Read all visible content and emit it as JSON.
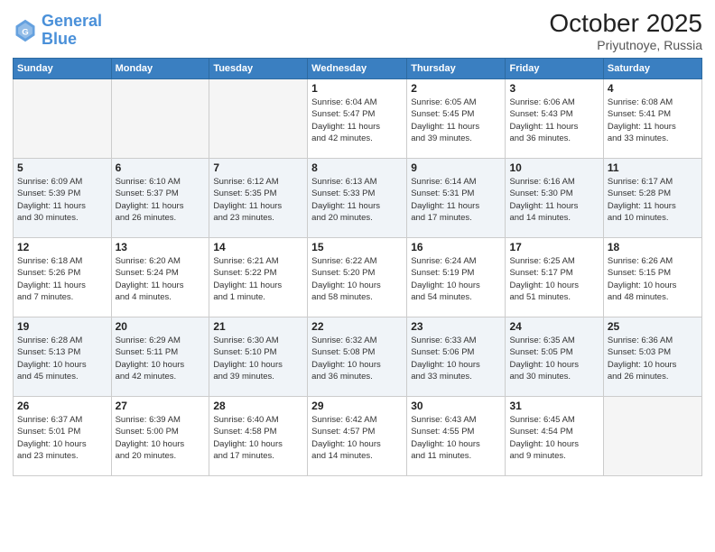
{
  "header": {
    "logo_line1": "General",
    "logo_line2": "Blue",
    "month": "October 2025",
    "location": "Priyutnoye, Russia"
  },
  "weekdays": [
    "Sunday",
    "Monday",
    "Tuesday",
    "Wednesday",
    "Thursday",
    "Friday",
    "Saturday"
  ],
  "weeks": [
    [
      {
        "day": "",
        "info": ""
      },
      {
        "day": "",
        "info": ""
      },
      {
        "day": "",
        "info": ""
      },
      {
        "day": "1",
        "info": "Sunrise: 6:04 AM\nSunset: 5:47 PM\nDaylight: 11 hours\nand 42 minutes."
      },
      {
        "day": "2",
        "info": "Sunrise: 6:05 AM\nSunset: 5:45 PM\nDaylight: 11 hours\nand 39 minutes."
      },
      {
        "day": "3",
        "info": "Sunrise: 6:06 AM\nSunset: 5:43 PM\nDaylight: 11 hours\nand 36 minutes."
      },
      {
        "day": "4",
        "info": "Sunrise: 6:08 AM\nSunset: 5:41 PM\nDaylight: 11 hours\nand 33 minutes."
      }
    ],
    [
      {
        "day": "5",
        "info": "Sunrise: 6:09 AM\nSunset: 5:39 PM\nDaylight: 11 hours\nand 30 minutes."
      },
      {
        "day": "6",
        "info": "Sunrise: 6:10 AM\nSunset: 5:37 PM\nDaylight: 11 hours\nand 26 minutes."
      },
      {
        "day": "7",
        "info": "Sunrise: 6:12 AM\nSunset: 5:35 PM\nDaylight: 11 hours\nand 23 minutes."
      },
      {
        "day": "8",
        "info": "Sunrise: 6:13 AM\nSunset: 5:33 PM\nDaylight: 11 hours\nand 20 minutes."
      },
      {
        "day": "9",
        "info": "Sunrise: 6:14 AM\nSunset: 5:31 PM\nDaylight: 11 hours\nand 17 minutes."
      },
      {
        "day": "10",
        "info": "Sunrise: 6:16 AM\nSunset: 5:30 PM\nDaylight: 11 hours\nand 14 minutes."
      },
      {
        "day": "11",
        "info": "Sunrise: 6:17 AM\nSunset: 5:28 PM\nDaylight: 11 hours\nand 10 minutes."
      }
    ],
    [
      {
        "day": "12",
        "info": "Sunrise: 6:18 AM\nSunset: 5:26 PM\nDaylight: 11 hours\nand 7 minutes."
      },
      {
        "day": "13",
        "info": "Sunrise: 6:20 AM\nSunset: 5:24 PM\nDaylight: 11 hours\nand 4 minutes."
      },
      {
        "day": "14",
        "info": "Sunrise: 6:21 AM\nSunset: 5:22 PM\nDaylight: 11 hours\nand 1 minute."
      },
      {
        "day": "15",
        "info": "Sunrise: 6:22 AM\nSunset: 5:20 PM\nDaylight: 10 hours\nand 58 minutes."
      },
      {
        "day": "16",
        "info": "Sunrise: 6:24 AM\nSunset: 5:19 PM\nDaylight: 10 hours\nand 54 minutes."
      },
      {
        "day": "17",
        "info": "Sunrise: 6:25 AM\nSunset: 5:17 PM\nDaylight: 10 hours\nand 51 minutes."
      },
      {
        "day": "18",
        "info": "Sunrise: 6:26 AM\nSunset: 5:15 PM\nDaylight: 10 hours\nand 48 minutes."
      }
    ],
    [
      {
        "day": "19",
        "info": "Sunrise: 6:28 AM\nSunset: 5:13 PM\nDaylight: 10 hours\nand 45 minutes."
      },
      {
        "day": "20",
        "info": "Sunrise: 6:29 AM\nSunset: 5:11 PM\nDaylight: 10 hours\nand 42 minutes."
      },
      {
        "day": "21",
        "info": "Sunrise: 6:30 AM\nSunset: 5:10 PM\nDaylight: 10 hours\nand 39 minutes."
      },
      {
        "day": "22",
        "info": "Sunrise: 6:32 AM\nSunset: 5:08 PM\nDaylight: 10 hours\nand 36 minutes."
      },
      {
        "day": "23",
        "info": "Sunrise: 6:33 AM\nSunset: 5:06 PM\nDaylight: 10 hours\nand 33 minutes."
      },
      {
        "day": "24",
        "info": "Sunrise: 6:35 AM\nSunset: 5:05 PM\nDaylight: 10 hours\nand 30 minutes."
      },
      {
        "day": "25",
        "info": "Sunrise: 6:36 AM\nSunset: 5:03 PM\nDaylight: 10 hours\nand 26 minutes."
      }
    ],
    [
      {
        "day": "26",
        "info": "Sunrise: 6:37 AM\nSunset: 5:01 PM\nDaylight: 10 hours\nand 23 minutes."
      },
      {
        "day": "27",
        "info": "Sunrise: 6:39 AM\nSunset: 5:00 PM\nDaylight: 10 hours\nand 20 minutes."
      },
      {
        "day": "28",
        "info": "Sunrise: 6:40 AM\nSunset: 4:58 PM\nDaylight: 10 hours\nand 17 minutes."
      },
      {
        "day": "29",
        "info": "Sunrise: 6:42 AM\nSunset: 4:57 PM\nDaylight: 10 hours\nand 14 minutes."
      },
      {
        "day": "30",
        "info": "Sunrise: 6:43 AM\nSunset: 4:55 PM\nDaylight: 10 hours\nand 11 minutes."
      },
      {
        "day": "31",
        "info": "Sunrise: 6:45 AM\nSunset: 4:54 PM\nDaylight: 10 hours\nand 9 minutes."
      },
      {
        "day": "",
        "info": ""
      }
    ]
  ]
}
